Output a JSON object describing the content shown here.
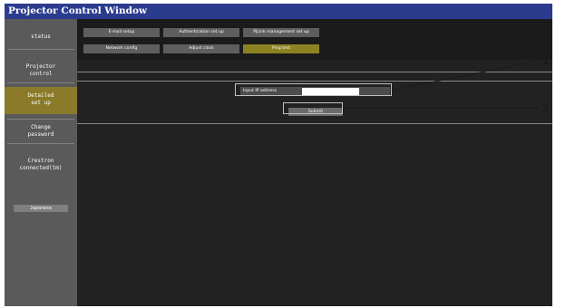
{
  "window": {
    "title": "Projector Control Window"
  },
  "sidebar": {
    "items": [
      {
        "label": "status",
        "active": false
      },
      {
        "label": "Projector\ncontrol",
        "active": false
      },
      {
        "label": "Detailed\nset up",
        "active": true
      },
      {
        "label": "Change\npassword",
        "active": false
      },
      {
        "label": "Crestron\nconnected(tm)",
        "active": false
      }
    ],
    "button_label": "Japanese"
  },
  "tabs": [
    {
      "label": "E-mail setup",
      "active": false
    },
    {
      "label": "Authentication set up",
      "active": false
    },
    {
      "label": "PJLink management set up",
      "active": false
    },
    {
      "label": "Network config",
      "active": false
    },
    {
      "label": "Adjust clock",
      "active": false
    },
    {
      "label": "Ping test",
      "active": true
    }
  ],
  "ping": {
    "label": "Input IP address",
    "input_value": "",
    "submit_label": "Submit"
  },
  "callouts": [
    "1",
    "2"
  ],
  "colors": {
    "title_bar": "#2b3c8e",
    "active_tab": "#8c8222",
    "active_sidebar": "#8a7a2a"
  }
}
